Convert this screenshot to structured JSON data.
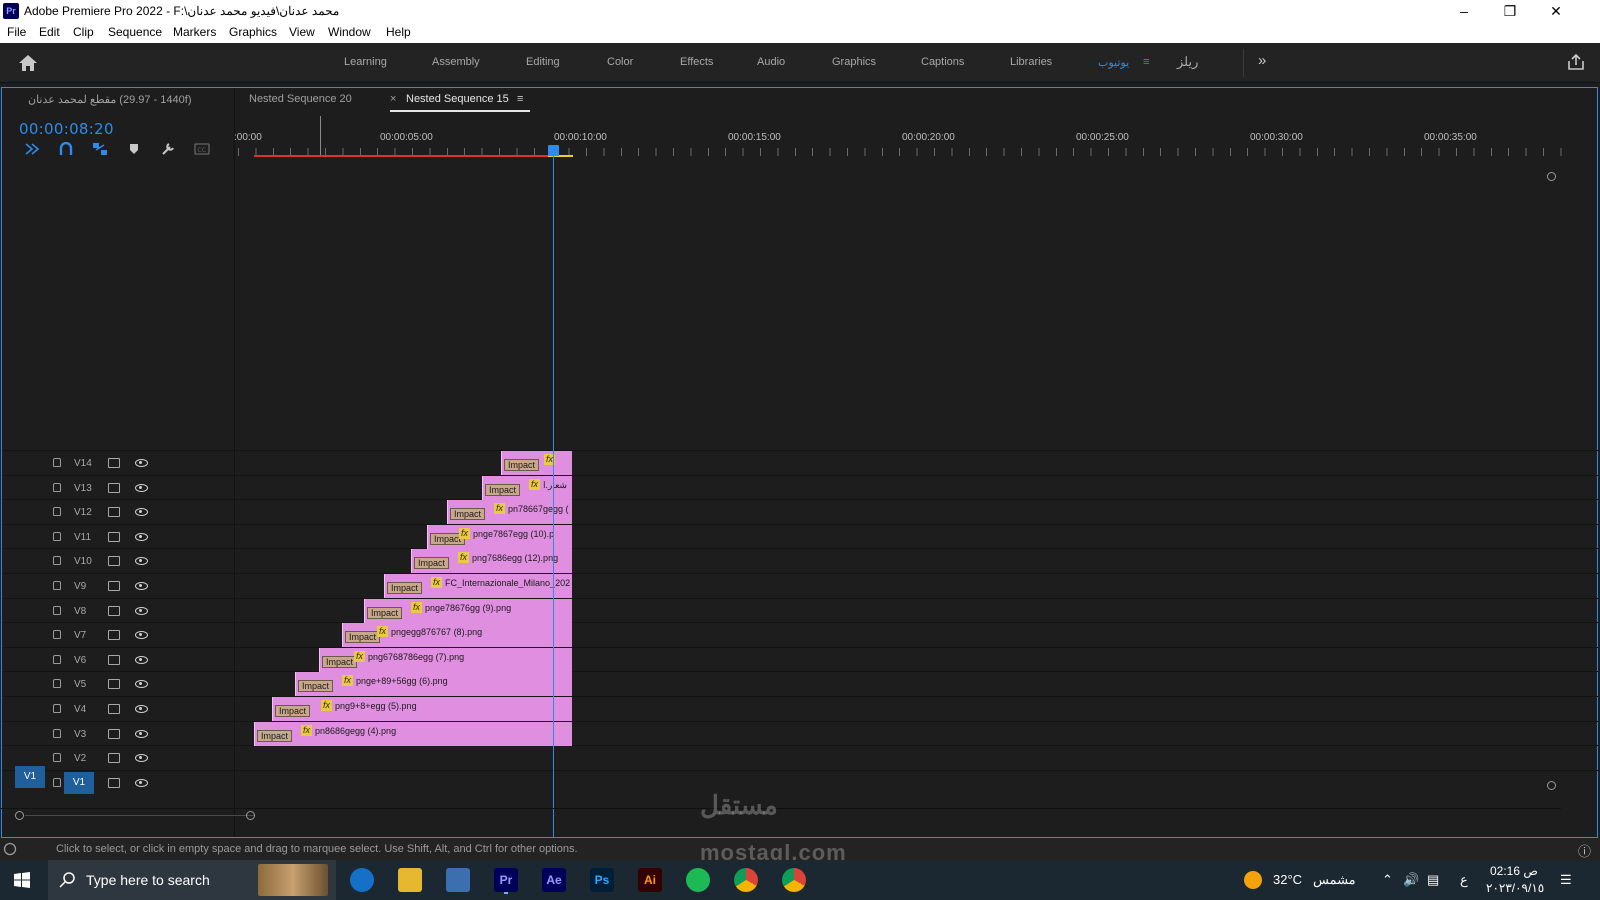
{
  "window": {
    "app_logo": "Pr",
    "title": "Adobe Premiere Pro 2022 - F:\\محمد عدنان\\فيديو محمد عدنان",
    "controls": [
      "minimize-icon",
      "restore-icon",
      "close-icon"
    ]
  },
  "menu": [
    "File",
    "Edit",
    "Clip",
    "Sequence",
    "Markers",
    "Graphics",
    "View",
    "Window",
    "Help"
  ],
  "workspaces": {
    "items": [
      "Learning",
      "Assembly",
      "Editing",
      "Color",
      "Effects",
      "Audio",
      "Graphics",
      "Captions",
      "Libraries",
      "يوتيوب",
      "ريلز"
    ],
    "active": "يوتيوب"
  },
  "tabs": {
    "t1": "مقطع لمحمد عدنان (1440 - 29.97f)",
    "t2": "Nested Sequence 20",
    "t3_close": "×",
    "t3": "Nested Sequence 15",
    "t3_menu": "≡"
  },
  "timecode": "00:00:08:20",
  "ruler": [
    ":00:00",
    "00:00:05:00",
    "00:00:10:00",
    "00:00:15:00",
    "00:00:20:00",
    "00:00:25:00",
    "00:00:30:00",
    "00:00:35:00"
  ],
  "tracks": [
    "V14",
    "V13",
    "V12",
    "V11",
    "V10",
    "V9",
    "V8",
    "V7",
    "V6",
    "V5",
    "V4",
    "V3",
    "V2",
    "V1"
  ],
  "source_patch": "V1",
  "clips": [
    {
      "track": "V14",
      "badge": "Impact",
      "fx": "fx",
      "name": ""
    },
    {
      "track": "V13",
      "badge": "Impact",
      "fx": "fx",
      "name": "شعار.ا"
    },
    {
      "track": "V12",
      "badge": "Impact",
      "fx": "fx",
      "name": "pn78667gegg ("
    },
    {
      "track": "V11",
      "badge": "Impact",
      "fx": "fx",
      "name": "pnge7867egg (10).p"
    },
    {
      "track": "V10",
      "badge": "Impact",
      "fx": "fx",
      "name": "png7686egg (12).png"
    },
    {
      "track": "V9",
      "badge": "Impact",
      "fx": "fx",
      "name": "FC_Internazionale_Milano_202"
    },
    {
      "track": "V8",
      "badge": "Impact",
      "fx": "fx",
      "name": "pnge78676gg (9).png"
    },
    {
      "track": "V7",
      "badge": "Impact",
      "fx": "fx",
      "name": "pngegg876767 (8).png"
    },
    {
      "track": "V6",
      "badge": "Impact",
      "fx": "fx",
      "name": "png6768786egg (7).png"
    },
    {
      "track": "V5",
      "badge": "Impact",
      "fx": "fx",
      "name": "pnge+89+56gg (6).png"
    },
    {
      "track": "V4",
      "badge": "Impact",
      "fx": "fx",
      "name": "png9+8+egg (5).png"
    },
    {
      "track": "V3",
      "badge": "Impact",
      "fx": "fx",
      "name": "pn8686gegg (4).png"
    }
  ],
  "status": "Click to select, or click in empty space and drag to marquee select. Use Shift, Alt, and Ctrl for other options.",
  "taskbar": {
    "search_placeholder": "Type here to search",
    "apps": [
      "Pr",
      "Ae",
      "Ps",
      "Ai"
    ],
    "weather": "32°C",
    "weather_label": "مشمس",
    "time": "02:16 ص",
    "date": "٢٠٢٣/٠٩/١٥",
    "lang": "ع"
  },
  "watermark": "مستقل",
  "watermark_url": "mostaql.com",
  "colors": {
    "accent": "#2d8ceb",
    "clip": "#e08fe0",
    "inout_red": "#e03030",
    "inout_yellow": "#e6d030"
  }
}
